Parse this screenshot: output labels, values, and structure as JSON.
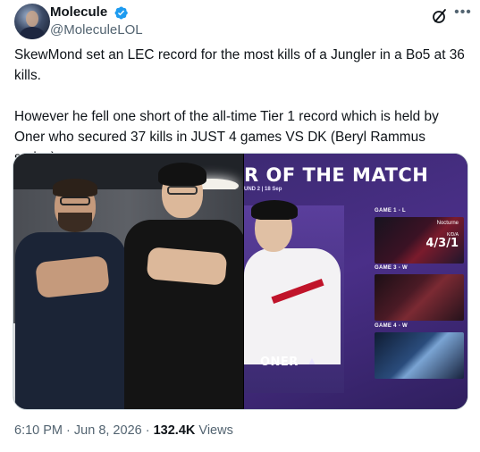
{
  "author": {
    "display_name": "Molecule",
    "handle": "@MoleculeLOL",
    "verified": true,
    "verified_color": "#1d9bf0"
  },
  "tweet": {
    "paragraphs": [
      "SkewMond set an LEC record for the most kills of a Jungler in a Bo5 at 36 kills.",
      "However he fell one short of the all-time Tier 1 record which is held by Oner who secured 37 kills in JUST 4 games VS DK (Beryl Rammus series)"
    ]
  },
  "media": {
    "right_image": {
      "title_partial": "R OF THE MATCH",
      "subtitle_partial": "UND 2 | 18 Sep",
      "player_name": "ONER",
      "games": [
        {
          "label": "GAME 1 - L",
          "champion": "Nocturne",
          "kda_label": "K/D/A",
          "kda": "4/3/1"
        },
        {
          "label": "GAME 3 - W"
        },
        {
          "label": "GAME 4 - W"
        }
      ]
    }
  },
  "meta": {
    "time": "6:10 PM",
    "separator": "·",
    "date": "Jun 8, 2026",
    "views_count": "132.4K",
    "views_label": "Views"
  },
  "icons": {
    "grok": "grok-icon",
    "more": "more-options-icon",
    "verified": "verified-badge-icon"
  }
}
